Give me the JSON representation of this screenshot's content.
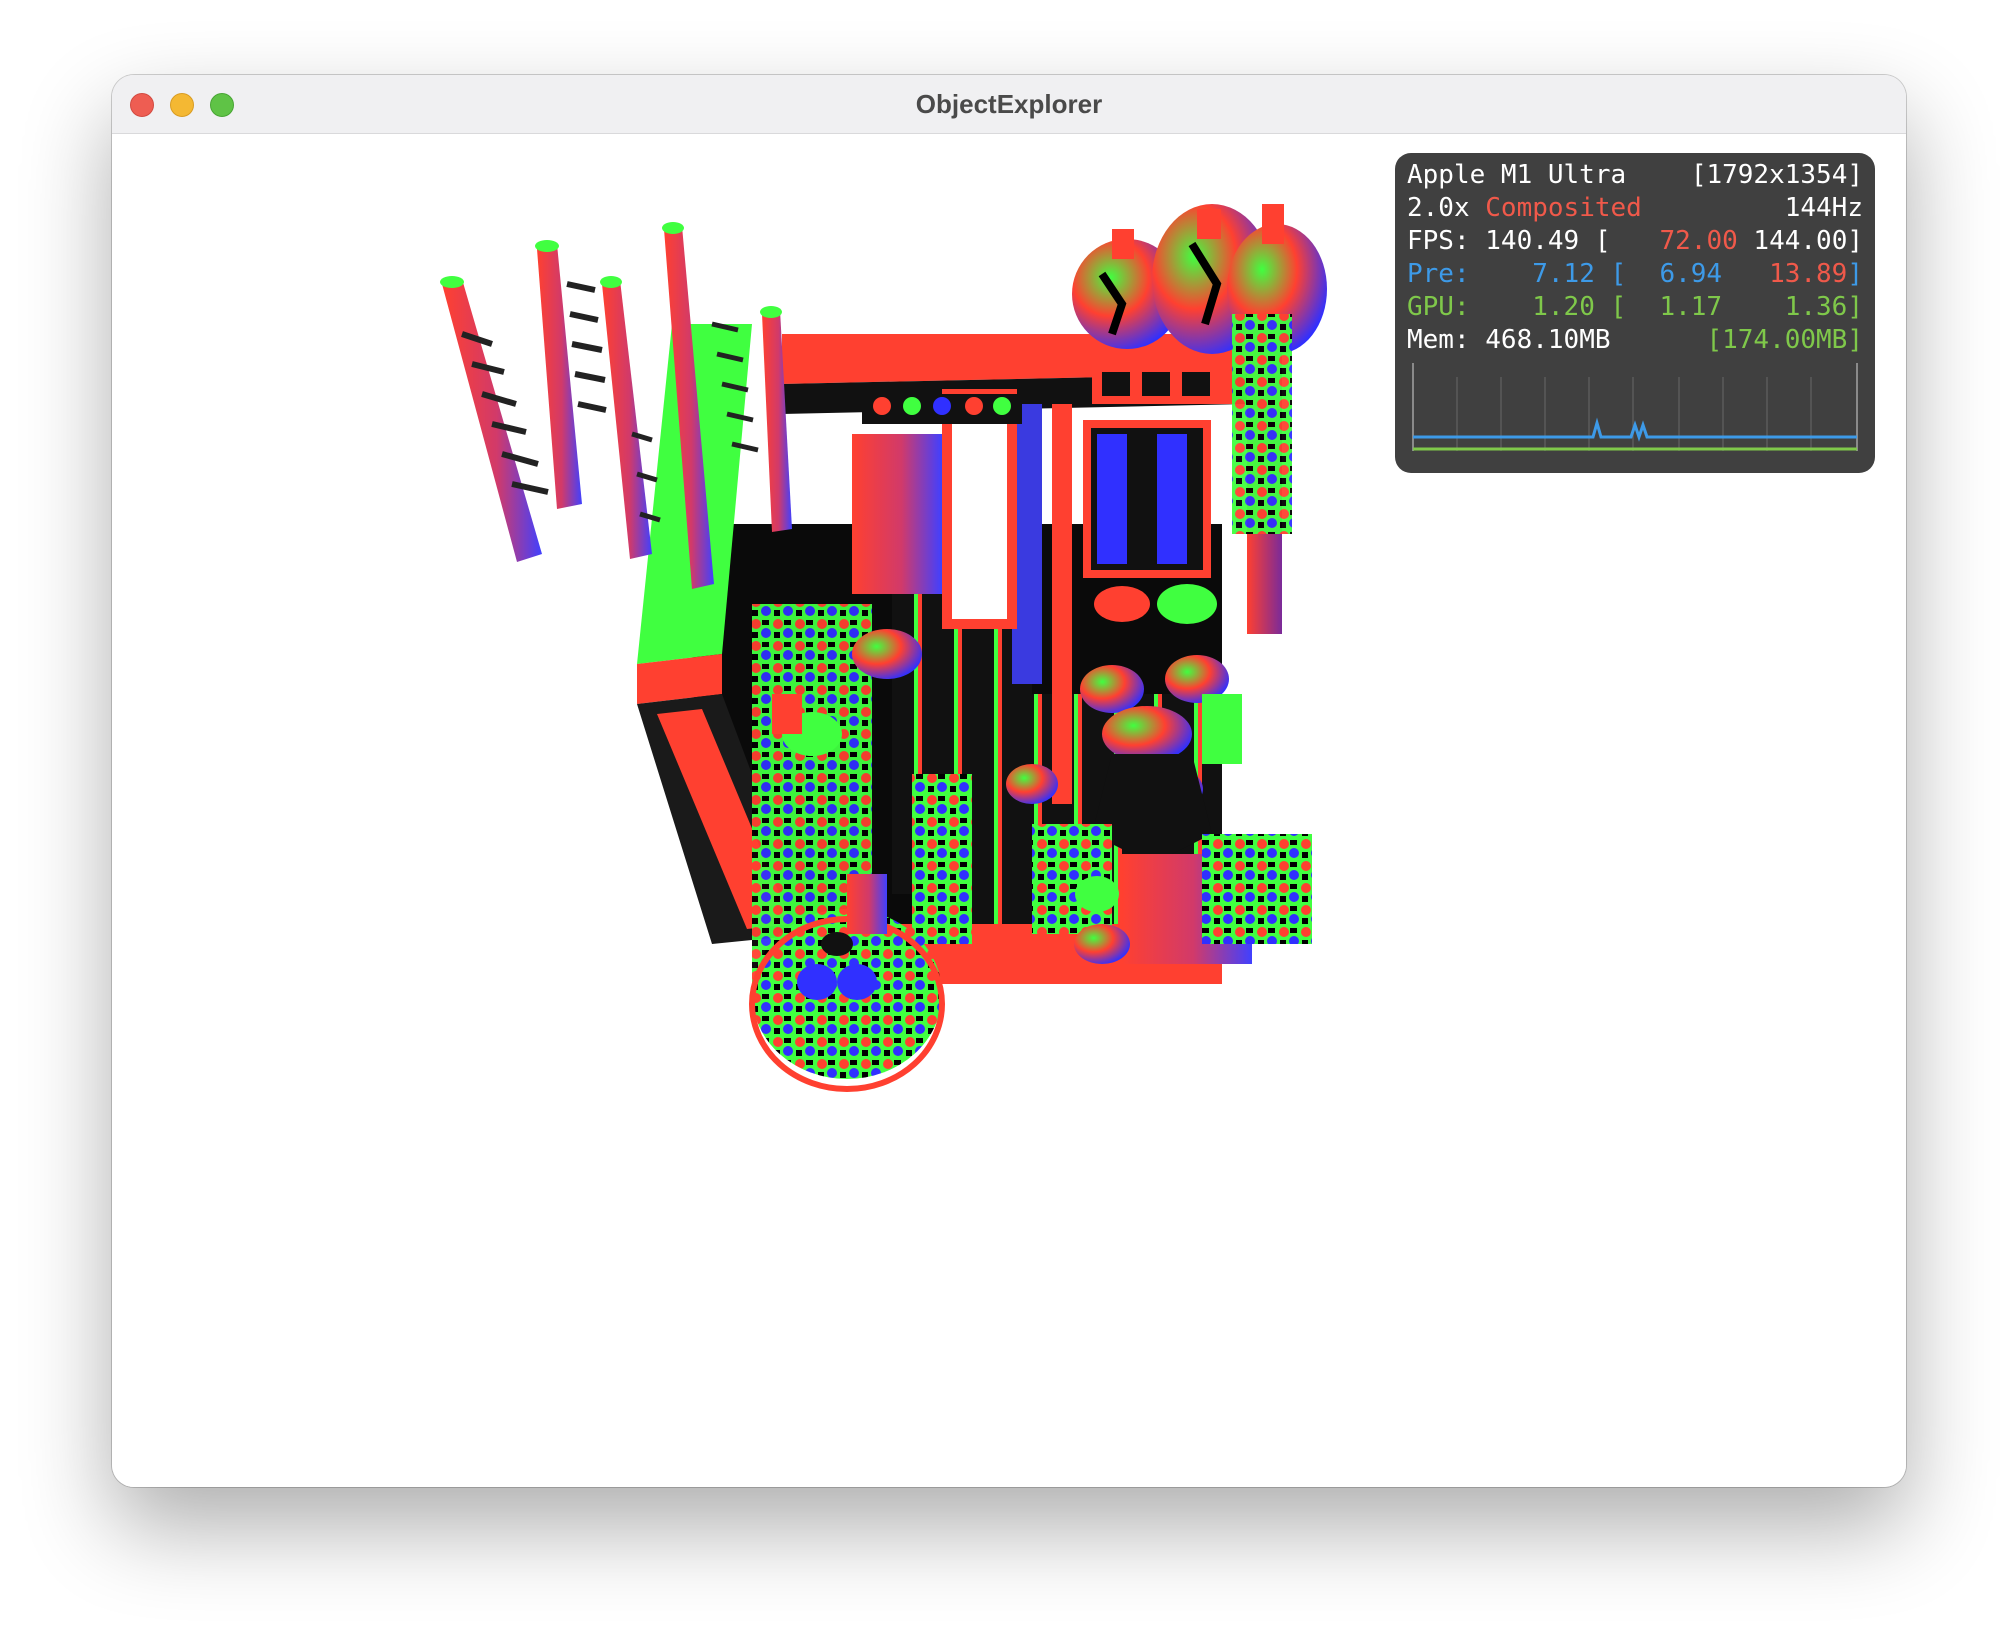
{
  "window": {
    "title": "ObjectExplorer"
  },
  "hud": {
    "row1": {
      "left": "Apple M1 Ultra",
      "right": "[1792x1354]"
    },
    "row2": {
      "scale": "2.0x",
      "mode": "Composited",
      "refresh": "144Hz"
    },
    "row3": {
      "label": "FPS:",
      "value": "140.49",
      "open": "[",
      "min": "72.00",
      "max": "144.00",
      "close": "]"
    },
    "row4": {
      "label": "Pre:",
      "value": "7.12",
      "open": "[",
      "min": "6.94",
      "max": "13.89",
      "close": "]"
    },
    "row5": {
      "label": "GPU:",
      "value": "1.20",
      "open": "[",
      "min": "1.17",
      "max": "1.36",
      "close": "]"
    },
    "row6": {
      "label": "Mem:",
      "value": "468.10MB",
      "extra": "[174.00MB]"
    },
    "colors": {
      "background": "#404040",
      "red": "#f0594a",
      "blue": "#3d9ae8",
      "green": "#7fc84a"
    }
  },
  "scene": {
    "description_icon": "normal-shaded-3d-model",
    "palette": [
      "#ff4030",
      "#40ff40",
      "#4040ff",
      "#000000"
    ]
  }
}
